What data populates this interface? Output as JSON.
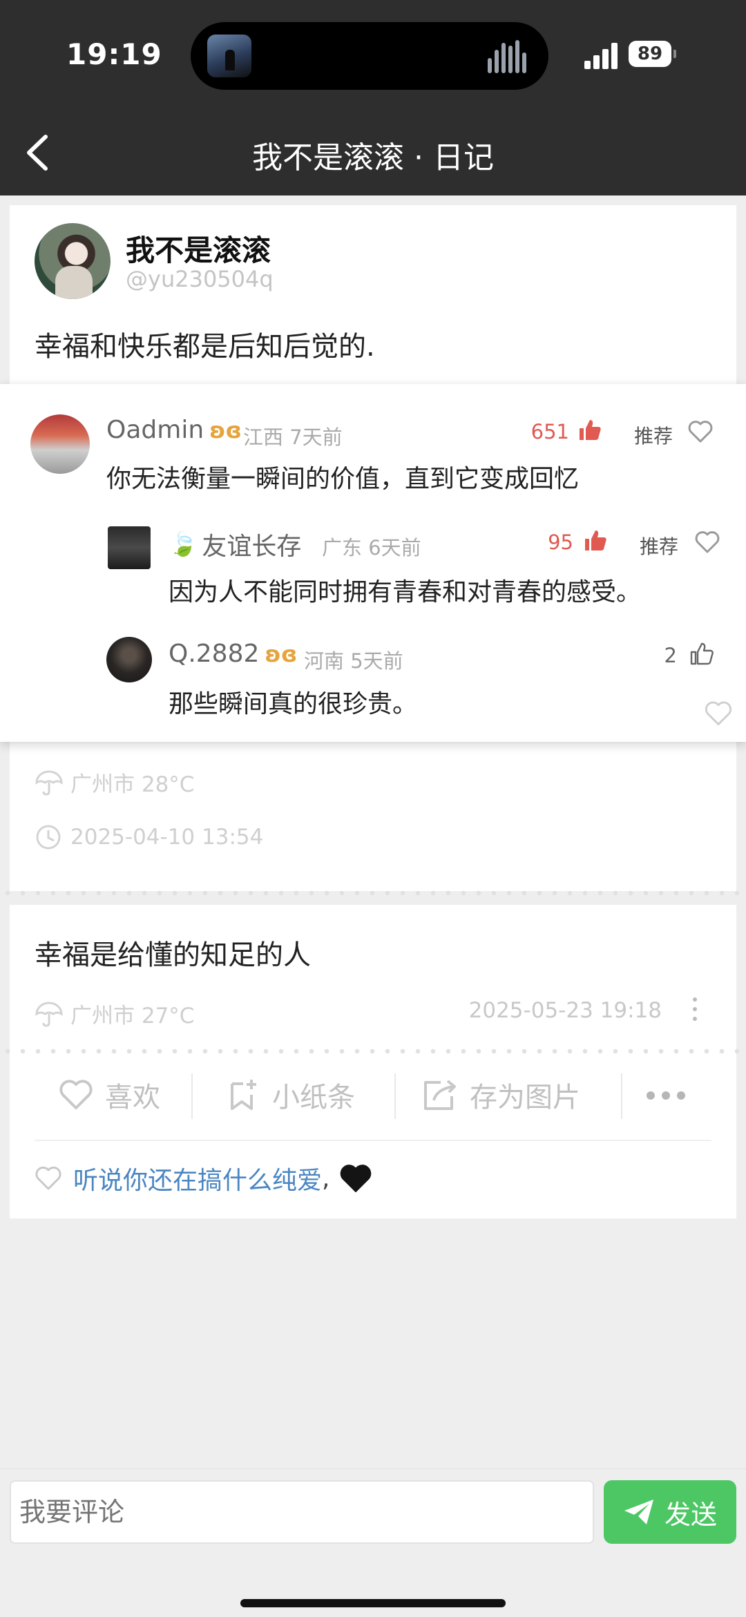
{
  "status_bar": {
    "time": "19:19",
    "battery": "89"
  },
  "nav": {
    "title": "我不是滚滚 · 日记"
  },
  "post": {
    "author_name": "我不是滚滚",
    "author_handle": "@yu230504q",
    "text": "幸福和快乐都是后知后觉的."
  },
  "comments": [
    {
      "name": "Oadmin",
      "badge": "ʚɞ",
      "location": "江西 7天前",
      "likes": "651",
      "recommend": "推荐",
      "text": "你无法衡量一瞬间的价值，直到它变成回忆"
    },
    {
      "leaf": "🍃",
      "name": "友谊长存",
      "location": "广东 6天前",
      "likes": "95",
      "recommend": "推荐",
      "text": "因为人不能同时拥有青春和对青春的感受。"
    },
    {
      "name": "Q.2882",
      "badge": "ʚɞ",
      "location": "河南 5天前",
      "likes": "2",
      "text": "那些瞬间真的很珍贵。"
    }
  ],
  "meta": {
    "weather": "广州市 28°C",
    "datetime": "2025-04-10 13:54"
  },
  "diary2": {
    "text": "幸福是给懂的知足的人",
    "weather": "广州市 27°C",
    "datetime": "2025-05-23 19:18"
  },
  "actions": {
    "like": "喜欢",
    "note": "小纸条",
    "save_image": "存为图片"
  },
  "liked_by": {
    "name": "听说你还在搞什么纯爱",
    "comma": ",",
    "heart": "🖤"
  },
  "comment_box": {
    "placeholder": "我要评论",
    "send": "发送"
  },
  "colors": {
    "accent_green": "#4cc764",
    "like_red": "#e05a52",
    "link_blue": "#4a86c2",
    "badge_gold": "#e6a43e"
  }
}
